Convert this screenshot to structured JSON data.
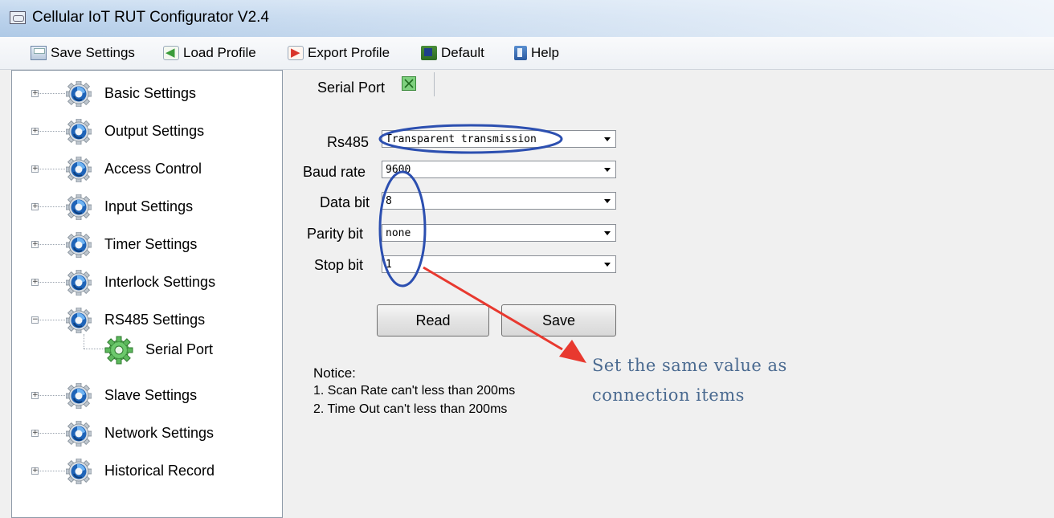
{
  "window": {
    "title": "Cellular IoT RUT Configurator V2.4"
  },
  "toolbar": {
    "save_settings": "Save Settings",
    "load_profile": "Load Profile",
    "export_profile": "Export Profile",
    "default": "Default",
    "help": "Help"
  },
  "tree": {
    "items": [
      {
        "label": "Basic Settings",
        "expander": "+"
      },
      {
        "label": "Output Settings",
        "expander": "+"
      },
      {
        "label": "Access Control",
        "expander": "+"
      },
      {
        "label": "Input Settings",
        "expander": "+"
      },
      {
        "label": "Timer Settings",
        "expander": "+"
      },
      {
        "label": "Interlock Settings",
        "expander": "+"
      },
      {
        "label": "RS485 Settings",
        "expander": "−"
      },
      {
        "label": "Slave Settings",
        "expander": "+"
      },
      {
        "label": "Network Settings",
        "expander": "+"
      },
      {
        "label": "Historical Record",
        "expander": "+"
      }
    ],
    "child": {
      "label": "Serial Port"
    }
  },
  "tab": {
    "label": "Serial Port"
  },
  "form": {
    "rs485": {
      "label": "Rs485",
      "value": "Transparent transmission"
    },
    "baud_rate": {
      "label": "Baud rate",
      "value": "9600"
    },
    "data_bit": {
      "label": "Data bit",
      "value": "8"
    },
    "parity_bit": {
      "label": "Parity bit",
      "value": "none"
    },
    "stop_bit": {
      "label": "Stop bit",
      "value": "1"
    }
  },
  "buttons": {
    "read": "Read",
    "save": "Save"
  },
  "notice": {
    "title": "Notice:",
    "line1": "1. Scan Rate can't less than 200ms",
    "line2": "2. Time Out  can't less than 200ms"
  },
  "annotation": {
    "line1": "Set the same value as",
    "line2": "connection items",
    "color": "#4a6a90",
    "ellipse_color": "#2c4fb0",
    "arrow_color": "#e8392f"
  }
}
